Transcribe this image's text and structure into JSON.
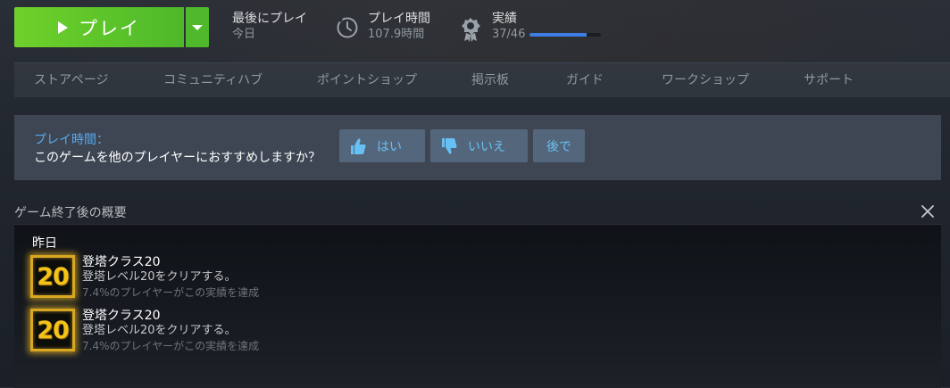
{
  "play": {
    "label": "プレイ"
  },
  "last_played": {
    "label": "最後にプレイ",
    "value": "今日"
  },
  "play_time": {
    "label": "プレイ時間",
    "value": "107.9時間"
  },
  "achievements": {
    "label": "実績",
    "value": "37/46",
    "progress_fraction": 0.804
  },
  "nav": {
    "items": [
      {
        "label": "ストアページ"
      },
      {
        "label": "コミュニティハブ"
      },
      {
        "label": "ポイントショップ"
      },
      {
        "label": "掲示板"
      },
      {
        "label": "ガイド"
      },
      {
        "label": "ワークショップ"
      },
      {
        "label": "サポート"
      }
    ]
  },
  "review": {
    "title": "プレイ時間：",
    "question": "このゲームを他のプレイヤーにおすすめしますか？",
    "yes_label": "はい",
    "no_label": "いいえ",
    "later_label": "後で"
  },
  "summary": {
    "title": "ゲーム終了後の概要",
    "day_label": "昨日",
    "achievements": [
      {
        "badge": "20",
        "name": "登塔クラス20",
        "description": "登塔レベル20をクリアする。",
        "percent": "7.4%のプレイヤーがこの実績を達成"
      },
      {
        "badge": "20",
        "name": "登塔クラス20",
        "description": "登塔レベル20をクリアする。",
        "percent": "7.4%のプレイヤーがこの実績を達成"
      }
    ]
  },
  "colors": {
    "play_green": "#6fd12a",
    "link_blue": "#66c0f4",
    "progress_blue": "#3d7ee6",
    "badge_gold": "#f5c21a"
  },
  "icons": {
    "clock": "clock-icon",
    "achievement": "achievement-icon",
    "thumbs_up": "thumbs-up-icon",
    "thumbs_down": "thumbs-down-icon",
    "close": "close-icon"
  }
}
